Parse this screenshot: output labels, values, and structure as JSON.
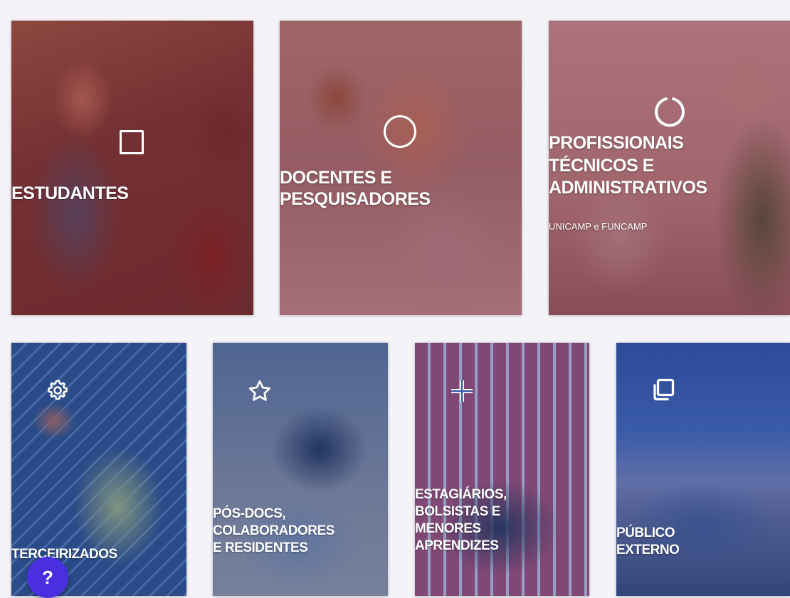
{
  "colors": {
    "row1_tint": "#7a1a22",
    "row2_tint": "#2846a0",
    "help_button": "#4a2fe0",
    "background": "#f3f3f8"
  },
  "cards": {
    "estudantes": {
      "title": "ESTUDANTES",
      "icon": "square-outline-icon"
    },
    "docentes": {
      "title_line1": "DOCENTES E",
      "title_line2": "PESQUISADORES",
      "icon": "circle-outline-icon"
    },
    "profissionais": {
      "title_line1": "PROFISSIONAIS",
      "title_line2": "TÉCNICOS E",
      "title_line3": "ADMINISTRATIVOS",
      "subtitle": "UNICAMP e FUNCAMP",
      "icon": "spinner-ring-icon"
    },
    "terceirizados": {
      "title": "TERCEIRIZADOS",
      "icon": "gear-icon"
    },
    "posdocs": {
      "title_line1": "PÓS-DOCS,",
      "title_line2": "COLABORADORES",
      "title_line3": "E RESIDENTES",
      "icon": "star-icon"
    },
    "estagiarios": {
      "title_line1": "ESTAGIÁRIOS,",
      "title_line2": "BOLSISTAS E",
      "title_line3": "MENORES",
      "title_line4": "APRENDIZES",
      "icon": "split-plus-icon"
    },
    "publico": {
      "title_line1": "PÚBLICO",
      "title_line2": "EXTERNO",
      "icon": "copy-icon"
    }
  },
  "help": {
    "label": "?"
  }
}
